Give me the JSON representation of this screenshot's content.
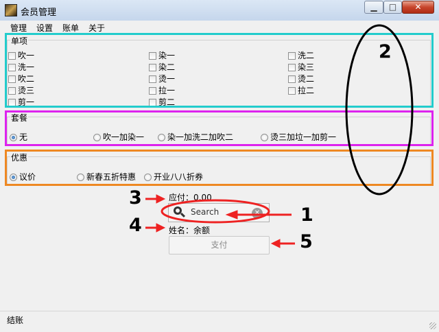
{
  "window": {
    "title": "会员管理",
    "minimize_glyph": "▁",
    "maximize_glyph": "□",
    "close_glyph": "✕"
  },
  "menu": [
    "管理",
    "设置",
    "账单",
    "关于"
  ],
  "single_items": {
    "title": "单项",
    "columns": [
      [
        "吹一",
        "洗一",
        "吹二",
        "烫三",
        "剪一"
      ],
      [
        "染一",
        "染二",
        "烫一",
        "拉一",
        "剪二"
      ],
      [
        "洗二",
        "染三",
        "烫二",
        "拉二"
      ]
    ]
  },
  "packages": {
    "title": "套餐",
    "options": [
      "无",
      "吹一加染一",
      "染一加洗二加吹二",
      "烫三加垃一加剪一"
    ],
    "selected": 0
  },
  "discount": {
    "title": "优惠",
    "options": [
      "议价",
      "新春五折特惠",
      "开业八八折券"
    ],
    "selected": 0
  },
  "payable_label": "应付：0.00",
  "search": {
    "placeholder": "Search",
    "clear_glyph": "✕"
  },
  "name_label": "姓名：余额",
  "pay_button": "支付",
  "status_text": "结账",
  "annotations": [
    "1",
    "2",
    "3",
    "4",
    "5"
  ],
  "highlight_colors": {
    "single": "#22cccc",
    "package": "#dd22ee",
    "discount": "#ee8822",
    "search": "#ee2222",
    "arrow": "#ee2222"
  }
}
